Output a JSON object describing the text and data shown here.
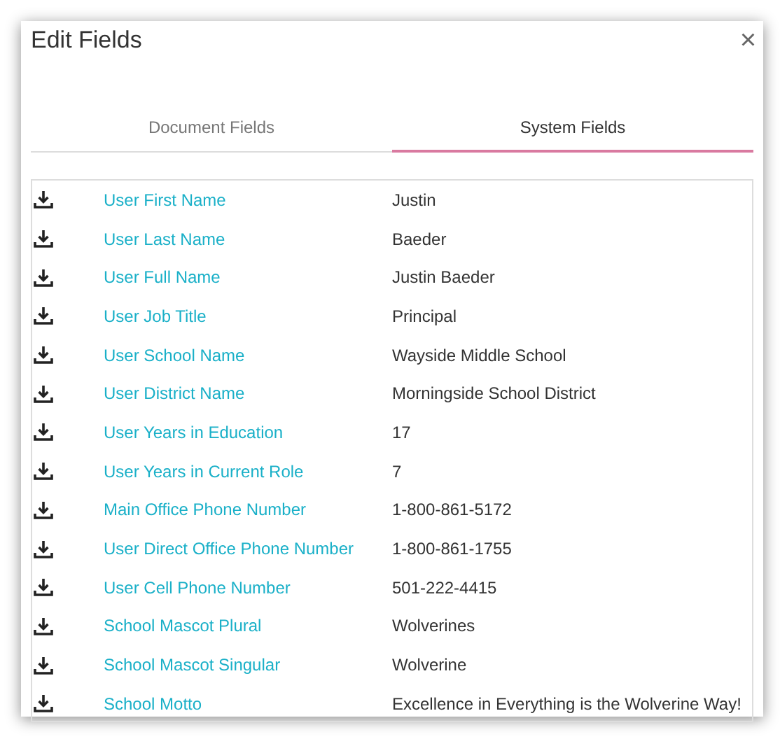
{
  "dialog": {
    "title": "Edit Fields",
    "close": "×"
  },
  "tabs": [
    {
      "label": "Document Fields",
      "selected": false
    },
    {
      "label": "System Fields",
      "selected": true
    }
  ],
  "fields": [
    {
      "name": "User First Name",
      "value": "Justin"
    },
    {
      "name": "User Last Name",
      "value": "Baeder"
    },
    {
      "name": "User Full Name",
      "value": "Justin Baeder"
    },
    {
      "name": "User Job Title",
      "value": "Principal"
    },
    {
      "name": "User School Name",
      "value": "Wayside Middle School"
    },
    {
      "name": "User District Name",
      "value": "Morningside School District"
    },
    {
      "name": "User Years in Education",
      "value": "17"
    },
    {
      "name": "User Years in Current Role",
      "value": "7"
    },
    {
      "name": "Main Office Phone Number",
      "value": "1-800-861-5172"
    },
    {
      "name": "User Direct Office Phone Number",
      "value": "1-800-861-1755"
    },
    {
      "name": "User Cell Phone Number",
      "value": "501-222-4415"
    },
    {
      "name": "School Mascot Plural",
      "value": "Wolverines"
    },
    {
      "name": "School Mascot Singular",
      "value": "Wolverine"
    },
    {
      "name": "School Motto",
      "value": "Excellence in Everything is the Wolverine Way!"
    }
  ]
}
